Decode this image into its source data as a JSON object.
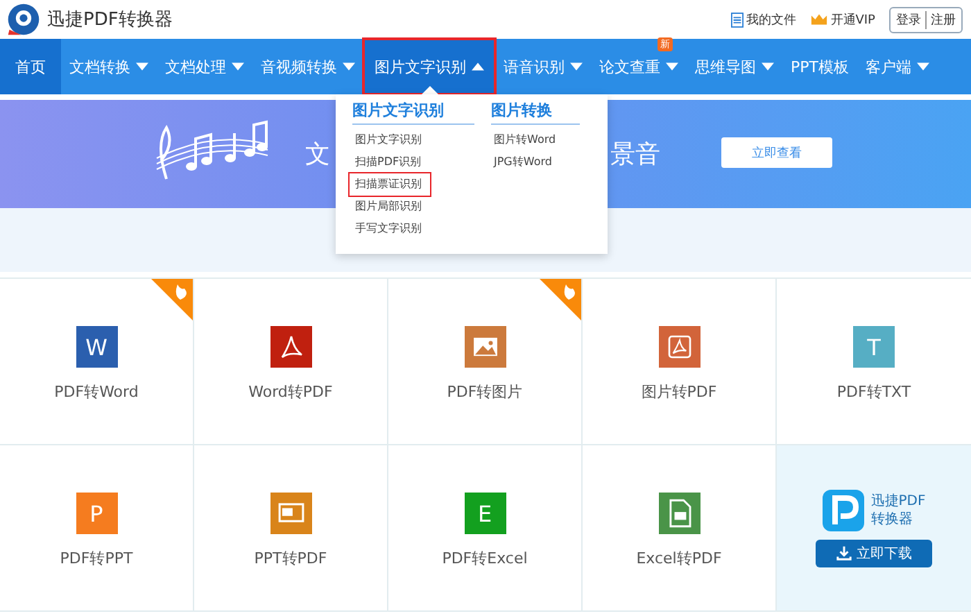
{
  "header": {
    "brand": "迅捷PDF转换器",
    "links": [
      {
        "label": "我的文件",
        "kind": "file"
      },
      {
        "label": "开通VIP",
        "kind": "vip"
      }
    ],
    "auth": [
      "登录",
      "注册"
    ]
  },
  "nav": [
    {
      "label": "首页",
      "selected": false,
      "home": true
    },
    {
      "label": "文档转换",
      "selected": false,
      "caret": true,
      "expanded": false
    },
    {
      "label": "文档处理",
      "selected": false,
      "caret": true,
      "expanded": false
    },
    {
      "label": "音视频转换",
      "selected": false,
      "caret": true,
      "expanded": false
    },
    {
      "label": "图片文字识别",
      "selected": true,
      "caret": true,
      "expanded": true,
      "highlighted": true
    },
    {
      "label": "语音识别",
      "selected": false,
      "caret": true,
      "expanded": false
    },
    {
      "label": "论文查重",
      "selected": false,
      "caret": true,
      "expanded": false,
      "badge": "新"
    },
    {
      "label": "思维导图",
      "selected": false,
      "caret": true,
      "expanded": false
    },
    {
      "label": "PPT模板",
      "selected": false
    },
    {
      "label": "客户端",
      "selected": false,
      "caret": true,
      "expanded": false
    }
  ],
  "dropdown": {
    "columns": [
      {
        "heading": "图片文字识别",
        "items": [
          {
            "label": "图片文字识别",
            "highlighted": false
          },
          {
            "label": "扫描PDF识别",
            "highlighted": false
          },
          {
            "label": "扫描票证识别",
            "highlighted": true
          },
          {
            "label": "图片局部识别",
            "highlighted": false
          },
          {
            "label": "手写文字识别",
            "highlighted": false
          }
        ]
      },
      {
        "heading": "图片转换",
        "items": [
          {
            "label": "图片转Word",
            "highlighted": false
          },
          {
            "label": "JPG转Word",
            "highlighted": false
          }
        ]
      }
    ]
  },
  "banner": {
    "title_left": "文",
    "title_right": "景音",
    "button": "立即查看"
  },
  "tiles": [
    {
      "label": "PDF转Word",
      "kind": "letter",
      "letter": "W",
      "color": "#2b5fae",
      "hot": true
    },
    {
      "label": "Word转PDF",
      "kind": "acrobat",
      "color": "#c0200f",
      "hot": false
    },
    {
      "label": "PDF转图片",
      "kind": "image",
      "color": "#cc7a3c",
      "hot": true
    },
    {
      "label": "图片转PDF",
      "kind": "acrobat-frame",
      "color": "#d2643a",
      "hot": false
    },
    {
      "label": "PDF转TXT",
      "kind": "letter",
      "letter": "T",
      "color": "#56aec4",
      "hot": false
    },
    {
      "label": "PDF转PPT",
      "kind": "letter",
      "letter": "P",
      "color": "#f57c1f",
      "hot": false
    },
    {
      "label": "PPT转PDF",
      "kind": "pdf-screen",
      "color": "#d9841a",
      "hot": false
    },
    {
      "label": "PDF转Excel",
      "kind": "letter",
      "letter": "E",
      "color": "#13a01f",
      "hot": false
    },
    {
      "label": "Excel转PDF",
      "kind": "pdf-doc",
      "color": "#4a9448",
      "hot": false
    }
  ],
  "promo": {
    "title_lines": [
      "迅捷PDF",
      "转换器"
    ],
    "button": "立即下载"
  }
}
